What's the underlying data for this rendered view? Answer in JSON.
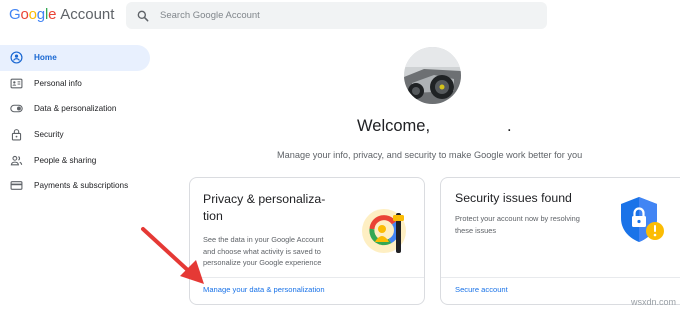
{
  "header": {
    "logo_google": "Google",
    "logo_account": "Account",
    "search_placeholder": "Search Google Account"
  },
  "sidebar": {
    "items": [
      {
        "label": "Home",
        "icon": "home-icon",
        "active": true
      },
      {
        "label": "Personal info",
        "icon": "id-card-icon",
        "active": false
      },
      {
        "label": "Data & personalization",
        "icon": "toggle-icon",
        "active": false
      },
      {
        "label": "Security",
        "icon": "lock-icon",
        "active": false
      },
      {
        "label": "People & sharing",
        "icon": "people-icon",
        "active": false
      },
      {
        "label": "Payments & subscriptions",
        "icon": "credit-card-icon",
        "active": false
      }
    ]
  },
  "profile": {
    "welcome": "Welcome,",
    "name_redacted": ".",
    "subtitle": "Manage your info, privacy, and security to make Google work better for you"
  },
  "cards": [
    {
      "title_line1": "Privacy & personaliza-",
      "title_line2": "tion",
      "desc_line1": "See the data in your Google Account",
      "desc_line2": "and choose what activity is saved to",
      "desc_line3": "personalize your Google experience",
      "link": "Manage your data & personalization",
      "icon": "privacy-illustration-icon"
    },
    {
      "title": "Security issues found",
      "desc_line1": "Protect your account now by resolving",
      "desc_line2": "these issues",
      "link": "Secure account",
      "icon": "security-shield-warning-icon"
    }
  ],
  "watermark": "wsxdn.com",
  "colors": {
    "accent_blue": "#1a73e8",
    "active_bg": "#e8f0fe",
    "arrow_red": "#e53935",
    "warning_yellow": "#fbbc04"
  }
}
